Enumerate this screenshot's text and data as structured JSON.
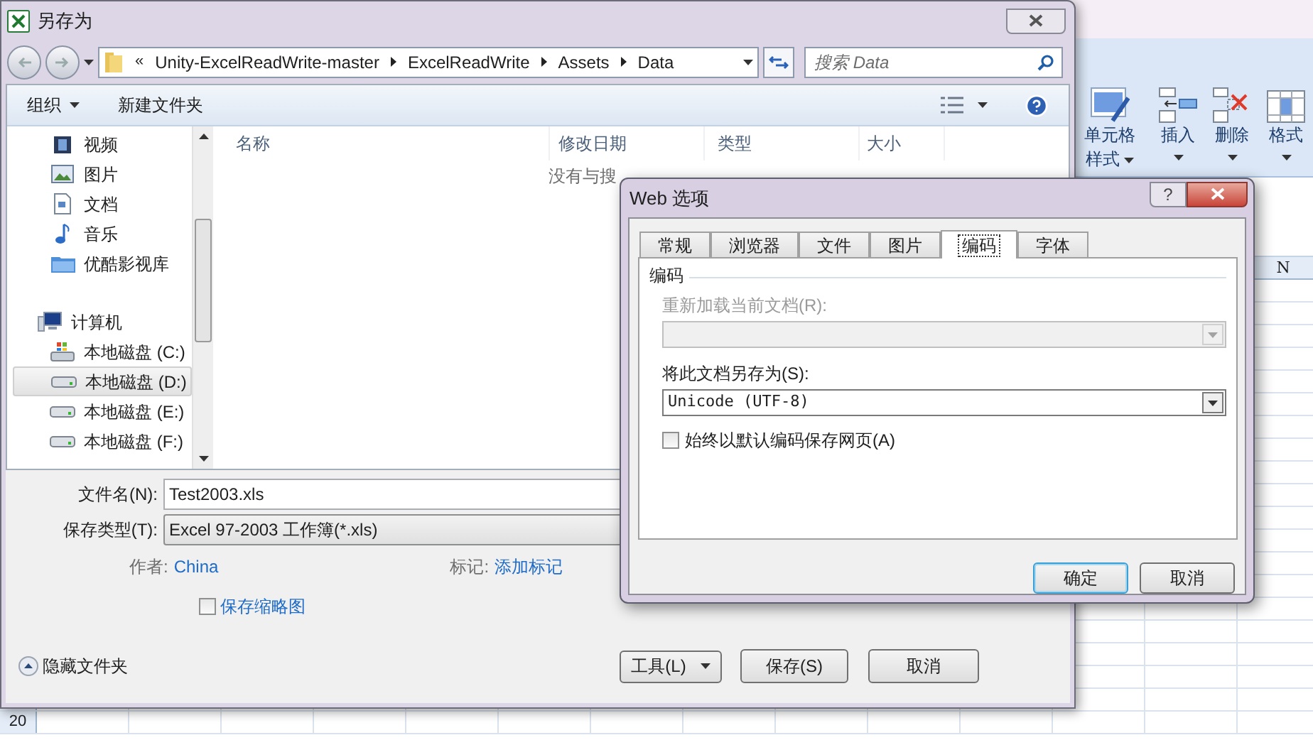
{
  "excel": {
    "ribbon": [
      {
        "lines": [
          "单元格",
          "样式"
        ],
        "kind": "styles"
      },
      {
        "lines": [
          "插入"
        ],
        "kind": "insert"
      },
      {
        "lines": [
          "删除"
        ],
        "kind": "delete"
      },
      {
        "lines": [
          "格式"
        ],
        "kind": "format"
      }
    ],
    "column_header": "N",
    "row_number": "20"
  },
  "save_dialog": {
    "title": "另存为",
    "address_prefix": "«",
    "path": [
      "Unity-ExcelReadWrite-master",
      "ExcelReadWrite",
      "Assets",
      "Data"
    ],
    "search": {
      "placeholder": "搜索 Data"
    },
    "toolbar": {
      "organize": "组织",
      "new_folder": "新建文件夹"
    },
    "nav_items": [
      {
        "label": "视频",
        "kind": "video",
        "selected": false
      },
      {
        "label": "图片",
        "kind": "picture",
        "selected": false
      },
      {
        "label": "文档",
        "kind": "document",
        "selected": false
      },
      {
        "label": "音乐",
        "kind": "music",
        "selected": false
      },
      {
        "label": "优酷影视库",
        "kind": "library",
        "selected": false
      },
      {
        "label": "计算机",
        "kind": "computer",
        "selected": false
      },
      {
        "label": "本地磁盘 (C:)",
        "kind": "system-drive",
        "selected": false
      },
      {
        "label": "本地磁盘 (D:)",
        "kind": "drive",
        "selected": true
      },
      {
        "label": "本地磁盘 (E:)",
        "kind": "drive",
        "selected": false
      },
      {
        "label": "本地磁盘 (F:)",
        "kind": "drive",
        "selected": false
      }
    ],
    "columns": [
      "名称",
      "修改日期",
      "类型",
      "大小"
    ],
    "empty_message": "没有与搜",
    "filename": {
      "label": "文件名(N):",
      "value": "Test2003.xls"
    },
    "filetype": {
      "label": "保存类型(T):",
      "value": "Excel 97-2003 工作簿(*.xls)"
    },
    "author": {
      "label": "作者:",
      "value": "China"
    },
    "tags": {
      "label": "标记:",
      "value": "添加标记"
    },
    "thumbnail": {
      "label": "保存缩略图",
      "checked": false
    },
    "hide_folders": "隐藏文件夹",
    "buttons": {
      "tools": "工具(L)",
      "save": "保存(S)",
      "cancel": "取消"
    }
  },
  "web_options": {
    "title": "Web 选项",
    "help": "?",
    "tabs": [
      {
        "label": "常规",
        "selected": false
      },
      {
        "label": "浏览器",
        "selected": false
      },
      {
        "label": "文件",
        "selected": false
      },
      {
        "label": "图片",
        "selected": false
      },
      {
        "label": "编码",
        "selected": true
      },
      {
        "label": "字体",
        "selected": false
      }
    ],
    "group": "编码",
    "reload": {
      "label": "重新加载当前文档(R):",
      "disabled": true
    },
    "save_as": {
      "label": "将此文档另存为(S):",
      "value": "Unicode (UTF-8)"
    },
    "always": {
      "label": "始终以默认编码保存网页(A)",
      "checked": false
    },
    "ok": "确定",
    "cancel": "取消"
  }
}
